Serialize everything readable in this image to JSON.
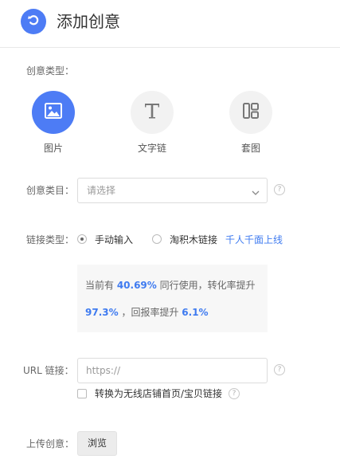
{
  "header": {
    "title": "添加创意",
    "back_icon": "undo-arrow-icon",
    "accent_color": "#4d7cf5"
  },
  "creative_type": {
    "label": "创意类型：",
    "options": [
      {
        "label": "图片",
        "icon": "image-icon",
        "selected": true
      },
      {
        "label": "文字链",
        "icon": "text-t-icon",
        "selected": false
      },
      {
        "label": "套图",
        "icon": "grid-layout-icon",
        "selected": false
      }
    ]
  },
  "category": {
    "label": "创意类目：",
    "placeholder": "请选择"
  },
  "link_type": {
    "label": "链接类型：",
    "options": [
      {
        "label": "手动输入",
        "checked": true
      },
      {
        "label": "淘积木链接",
        "checked": false
      }
    ],
    "link": "千人千面上线"
  },
  "stats": {
    "line1_prefix": "当前有 ",
    "line1_value": "40.69%",
    "line1_suffix": " 同行使用，转化率提升",
    "line2_value1": "97.3%",
    "line2_middle": " ，回报率提升 ",
    "line2_value2": "6.1%",
    "highlight_color": "#3f7bf0"
  },
  "url": {
    "label": "URL 链接：",
    "placeholder": "https://",
    "value": "",
    "convert_checkbox_label": "转换为无线店铺首页/宝贝链接",
    "convert_checked": false
  },
  "upload": {
    "label": "上传创意：",
    "button": "浏览"
  }
}
